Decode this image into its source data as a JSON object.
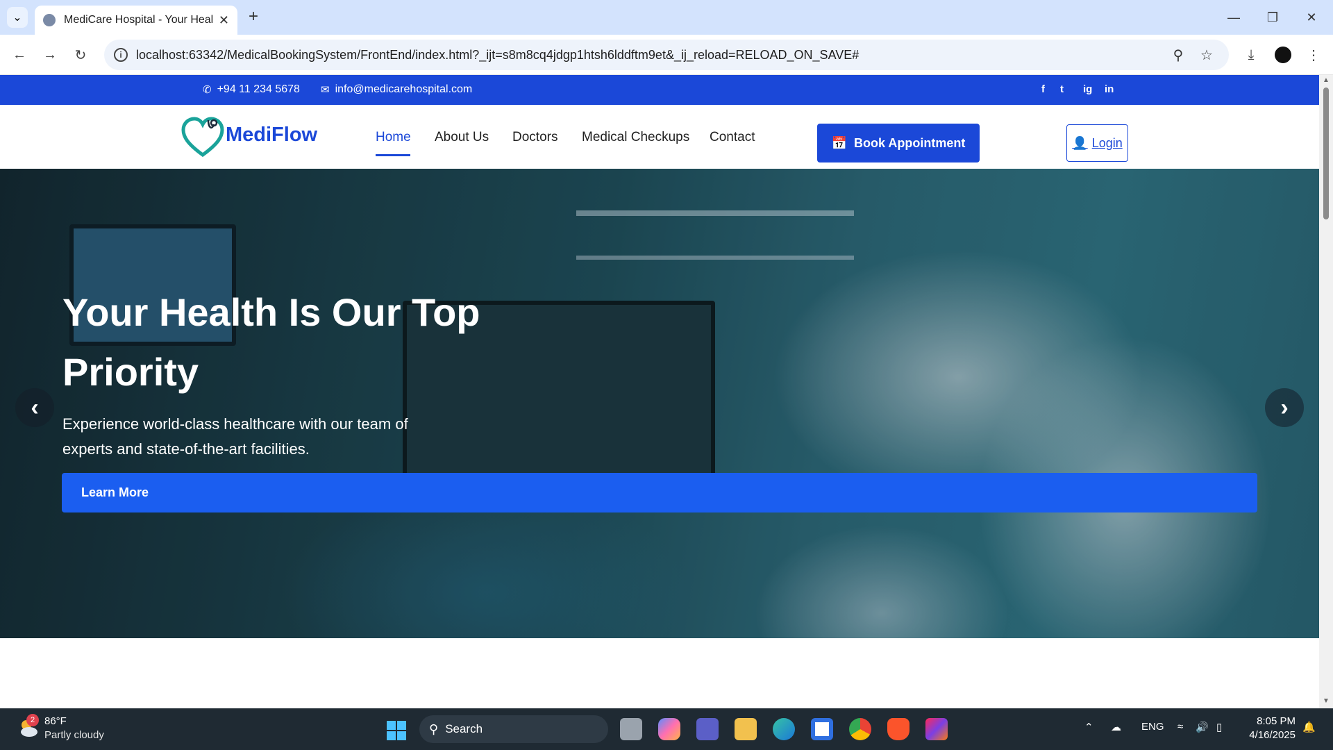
{
  "browser": {
    "tab_title": "MediCare Hospital - Your Healt",
    "new_tab": "+",
    "url": "localhost:63342/MedicalBookingSystem/FrontEnd/index.html?_ijt=s8m8cq4jdgp1htsh6lddftm9et&_ij_reload=RELOAD_ON_SAVE#"
  },
  "topbar": {
    "phone": "+94 11 234 5678",
    "email": "info@medicarehospital.com",
    "social": [
      "f",
      "t",
      "ig",
      "in"
    ]
  },
  "navbar": {
    "logo_text": "MediFlow",
    "links": [
      "Home",
      "About Us",
      "Doctors",
      "Medical Checkups",
      "Contact"
    ],
    "active_link": "Home",
    "book_label": "Book Appointment",
    "login_label": "Login"
  },
  "hero": {
    "title": "Your Health Is Our Top Priority",
    "subtitle": "Experience world-class healthcare with our team of experts and state-of-the-art facilities.",
    "cta_label": "Learn More"
  },
  "taskbar": {
    "weather_temp": "86°F",
    "weather_desc": "Partly cloudy",
    "weather_badge": "2",
    "search_label": "Search",
    "language": "ENG",
    "time": "8:05 PM",
    "date": "4/16/2025"
  },
  "colors": {
    "brand_blue": "#1b48d8",
    "cta_blue": "#1b5ef0",
    "tabbar": "#d3e3fd",
    "taskbar": "#1f2a33"
  }
}
